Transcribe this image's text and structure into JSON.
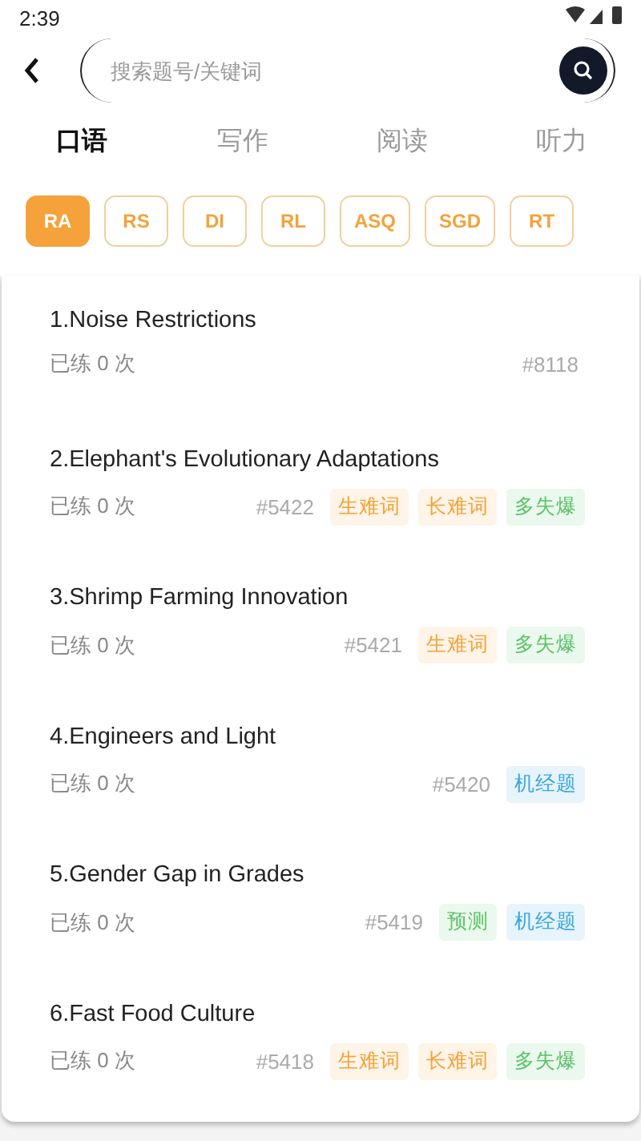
{
  "status_bar": {
    "time": "2:39"
  },
  "search": {
    "placeholder": "搜索题号/关键词"
  },
  "tabs": [
    {
      "label": "口语",
      "selected": true
    },
    {
      "label": "写作",
      "selected": false
    },
    {
      "label": "阅读",
      "selected": false
    },
    {
      "label": "听力",
      "selected": false
    }
  ],
  "chips": [
    {
      "label": "RA",
      "selected": true
    },
    {
      "label": "RS",
      "selected": false
    },
    {
      "label": "DI",
      "selected": false
    },
    {
      "label": "RL",
      "selected": false
    },
    {
      "label": "ASQ",
      "selected": false
    },
    {
      "label": "SGD",
      "selected": false
    },
    {
      "label": "RT",
      "selected": false
    }
  ],
  "questions": [
    {
      "title": "1.Noise Restrictions",
      "practiced": "已练 0 次",
      "number": "#8118"
    },
    {
      "title": "2.Elephant's Evolutionary Adaptations",
      "practiced": "已练 0 次",
      "number": "#5422",
      "tags": [
        {
          "label": "生难词",
          "color": "#f5a23a"
        },
        {
          "label": "长难词",
          "color": "#f5a23a"
        },
        {
          "label": "多失爆",
          "color": "#5cc26a"
        }
      ]
    },
    {
      "title": "3.Shrimp Farming Innovation",
      "practiced": "已练 0 次",
      "number": "#5421",
      "tags": [
        {
          "label": "生难词",
          "color": "#f5a23a"
        },
        {
          "label": "多失爆",
          "color": "#5cc26a"
        }
      ]
    },
    {
      "title": "4.Engineers and Light",
      "practiced": "已练 0 次",
      "number": "#5420",
      "tags": [
        {
          "label": "机经题",
          "color": "#3aa6e0"
        }
      ]
    },
    {
      "title": "5.Gender Gap in Grades",
      "practiced": "已练 0 次",
      "number": "#5419",
      "tags": [
        {
          "label": "预测",
          "color": "#5cc26a"
        },
        {
          "label": "机经题",
          "color": "#3aa6e0"
        }
      ]
    },
    {
      "title": "6.Fast Food Culture",
      "practiced": "已练 0 次",
      "number": "#5418",
      "tags": [
        {
          "label": "生难词",
          "color": "#f5a23a"
        },
        {
          "label": "长难词",
          "color": "#f5a23a"
        },
        {
          "label": "多失爆",
          "color": "#5cc26a"
        }
      ]
    }
  ]
}
